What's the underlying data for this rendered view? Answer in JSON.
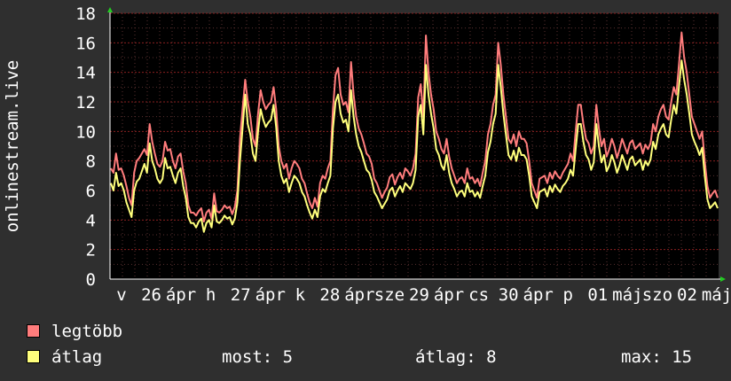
{
  "chart_data": {
    "type": "line",
    "ylabel": "onlinestream.live",
    "ylim": [
      0,
      18
    ],
    "yticks": [
      0,
      2,
      4,
      6,
      8,
      10,
      12,
      14,
      16,
      18
    ],
    "xtick_labels": [
      "v",
      "26",
      "ápr",
      "h",
      "27",
      "ápr",
      "k",
      "28",
      "ápr",
      "sze",
      "29",
      "ápr",
      "cs",
      "30",
      "ápr",
      "p",
      "01",
      "máj",
      "szo",
      "02",
      "máj"
    ],
    "grid": true,
    "series": [
      {
        "name": "legtöbb",
        "color": "#ff7c7c",
        "values": [
          7.5,
          7.2,
          8.5,
          7.4,
          7.5,
          7.0,
          6.3,
          5.5,
          5.0,
          7.2,
          8.0,
          8.2,
          8.5,
          8.8,
          8.4,
          10.5,
          9.3,
          8.5,
          7.8,
          7.6,
          8.0,
          9.3,
          8.7,
          8.8,
          8.0,
          7.5,
          8.3,
          8.5,
          7.3,
          6.5,
          5.0,
          4.5,
          4.5,
          4.3,
          4.6,
          4.8,
          3.9,
          4.5,
          4.7,
          4.1,
          5.8,
          4.6,
          4.5,
          4.7,
          5.0,
          4.8,
          4.9,
          4.4,
          4.9,
          6.0,
          9.5,
          11.5,
          13.5,
          12.0,
          11.0,
          9.5,
          9.0,
          11.2,
          12.8,
          12.0,
          11.5,
          11.8,
          12.0,
          13.0,
          11.5,
          9.0,
          8.0,
          7.5,
          7.8,
          6.8,
          7.5,
          8.0,
          7.8,
          7.5,
          6.8,
          6.5,
          5.8,
          5.2,
          4.8,
          5.5,
          4.9,
          6.5,
          7.0,
          6.8,
          7.5,
          8.0,
          11.5,
          13.8,
          14.3,
          12.5,
          11.8,
          12.0,
          11.3,
          14.7,
          12.5,
          11.0,
          10.2,
          9.8,
          9.2,
          8.5,
          8.3,
          7.8,
          6.8,
          6.5,
          6.0,
          5.5,
          5.9,
          6.2,
          6.9,
          7.1,
          6.4,
          6.9,
          7.2,
          6.8,
          7.5,
          7.3,
          7.0,
          7.5,
          8.5,
          12.3,
          13.2,
          11.0,
          16.5,
          14.0,
          12.5,
          11.5,
          10.0,
          9.5,
          8.8,
          8.5,
          9.5,
          8.3,
          7.5,
          7.0,
          6.5,
          6.8,
          6.9,
          6.5,
          7.5,
          6.8,
          6.9,
          6.5,
          6.8,
          6.3,
          7.2,
          8.0,
          9.8,
          10.5,
          11.8,
          12.5,
          16.0,
          14.5,
          12.5,
          11.0,
          9.5,
          9.2,
          9.8,
          9.0,
          10.0,
          9.5,
          9.5,
          9.2,
          8.0,
          6.5,
          6.0,
          5.5,
          6.8,
          6.9,
          7.0,
          6.5,
          7.2,
          6.8,
          7.3,
          7.0,
          6.8,
          7.2,
          7.5,
          7.8,
          8.5,
          8.0,
          10.0,
          11.8,
          11.8,
          10.5,
          9.5,
          9.2,
          8.5,
          9.0,
          11.8,
          10.2,
          9.0,
          9.5,
          8.3,
          8.8,
          9.5,
          9.0,
          8.2,
          8.8,
          9.5,
          9.0,
          8.5,
          9.2,
          9.4,
          8.8,
          9.0,
          9.2,
          8.5,
          9.1,
          8.8,
          9.2,
          10.5,
          10.0,
          11.0,
          11.5,
          11.8,
          11.0,
          10.8,
          12.0,
          13.0,
          12.5,
          14.5,
          16.7,
          15.0,
          14.0,
          12.5,
          11.0,
          10.5,
          10.0,
          9.5,
          10.0,
          8.0,
          6.3,
          5.5,
          5.8,
          6.0,
          5.5
        ]
      },
      {
        "name": "átlag",
        "color": "#ffff7c",
        "values": [
          6.5,
          6.0,
          7.2,
          6.3,
          6.5,
          6.0,
          5.2,
          4.7,
          4.2,
          6.0,
          6.6,
          6.8,
          7.3,
          7.8,
          7.2,
          9.2,
          8.0,
          7.5,
          6.8,
          6.5,
          6.8,
          8.2,
          7.5,
          7.6,
          7.0,
          6.5,
          7.2,
          7.5,
          6.3,
          5.5,
          4.2,
          3.8,
          3.8,
          3.5,
          3.9,
          4.1,
          3.2,
          3.8,
          4.0,
          3.5,
          5.0,
          3.9,
          3.8,
          4.0,
          4.3,
          4.1,
          4.2,
          3.7,
          4.1,
          5.2,
          8.0,
          10.2,
          12.5,
          10.5,
          9.8,
          8.5,
          8.0,
          10.0,
          11.5,
          10.8,
          10.3,
          10.6,
          10.8,
          11.8,
          10.3,
          8.0,
          7.0,
          6.5,
          6.8,
          5.9,
          6.5,
          7.0,
          6.8,
          6.5,
          5.9,
          5.6,
          5.0,
          4.5,
          4.1,
          4.7,
          4.2,
          5.6,
          6.1,
          5.9,
          6.5,
          7.0,
          10.2,
          12.0,
          12.5,
          11.2,
          10.6,
          10.8,
          10.0,
          12.8,
          11.0,
          9.8,
          9.0,
          8.6,
          8.0,
          7.4,
          7.2,
          6.7,
          5.9,
          5.6,
          5.2,
          4.8,
          5.1,
          5.4,
          6.0,
          6.2,
          5.6,
          6.0,
          6.3,
          5.9,
          6.5,
          6.3,
          6.1,
          6.5,
          7.4,
          11.0,
          11.8,
          9.8,
          14.5,
          12.5,
          11.2,
          10.2,
          8.8,
          8.4,
          7.7,
          7.4,
          8.4,
          7.2,
          6.5,
          6.1,
          5.6,
          5.9,
          6.0,
          5.6,
          6.5,
          5.9,
          6.0,
          5.6,
          5.9,
          5.5,
          6.3,
          7.0,
          8.6,
          9.3,
          10.5,
          11.2,
          14.5,
          13.0,
          11.2,
          9.8,
          8.4,
          8.1,
          8.7,
          8.0,
          8.9,
          8.4,
          8.4,
          8.1,
          7.0,
          5.6,
          5.2,
          4.8,
          5.9,
          6.0,
          6.1,
          5.6,
          6.3,
          5.9,
          6.4,
          6.1,
          5.9,
          6.3,
          6.5,
          6.8,
          7.4,
          7.0,
          8.8,
          10.5,
          10.5,
          9.3,
          8.4,
          8.1,
          7.4,
          7.9,
          10.5,
          9.0,
          7.9,
          8.4,
          7.3,
          7.7,
          8.4,
          7.9,
          7.2,
          7.7,
          8.4,
          7.9,
          7.4,
          8.1,
          8.3,
          7.7,
          7.9,
          8.1,
          7.4,
          8.0,
          7.7,
          8.1,
          9.3,
          8.8,
          9.8,
          10.2,
          10.5,
          9.8,
          9.6,
          10.8,
          11.8,
          11.2,
          13.0,
          14.8,
          13.5,
          12.5,
          11.2,
          9.8,
          9.3,
          8.9,
          8.4,
          8.9,
          7.0,
          5.4,
          4.8,
          5.0,
          5.2,
          4.8
        ]
      }
    ]
  },
  "legend": {
    "items": [
      {
        "label": "legtöbb",
        "color": "#ff7c7c"
      },
      {
        "label": "átlag",
        "color": "#ffff7c"
      }
    ],
    "stats": {
      "now": "most: 5",
      "avg": "átlag: 8",
      "max": "max: 15"
    }
  }
}
